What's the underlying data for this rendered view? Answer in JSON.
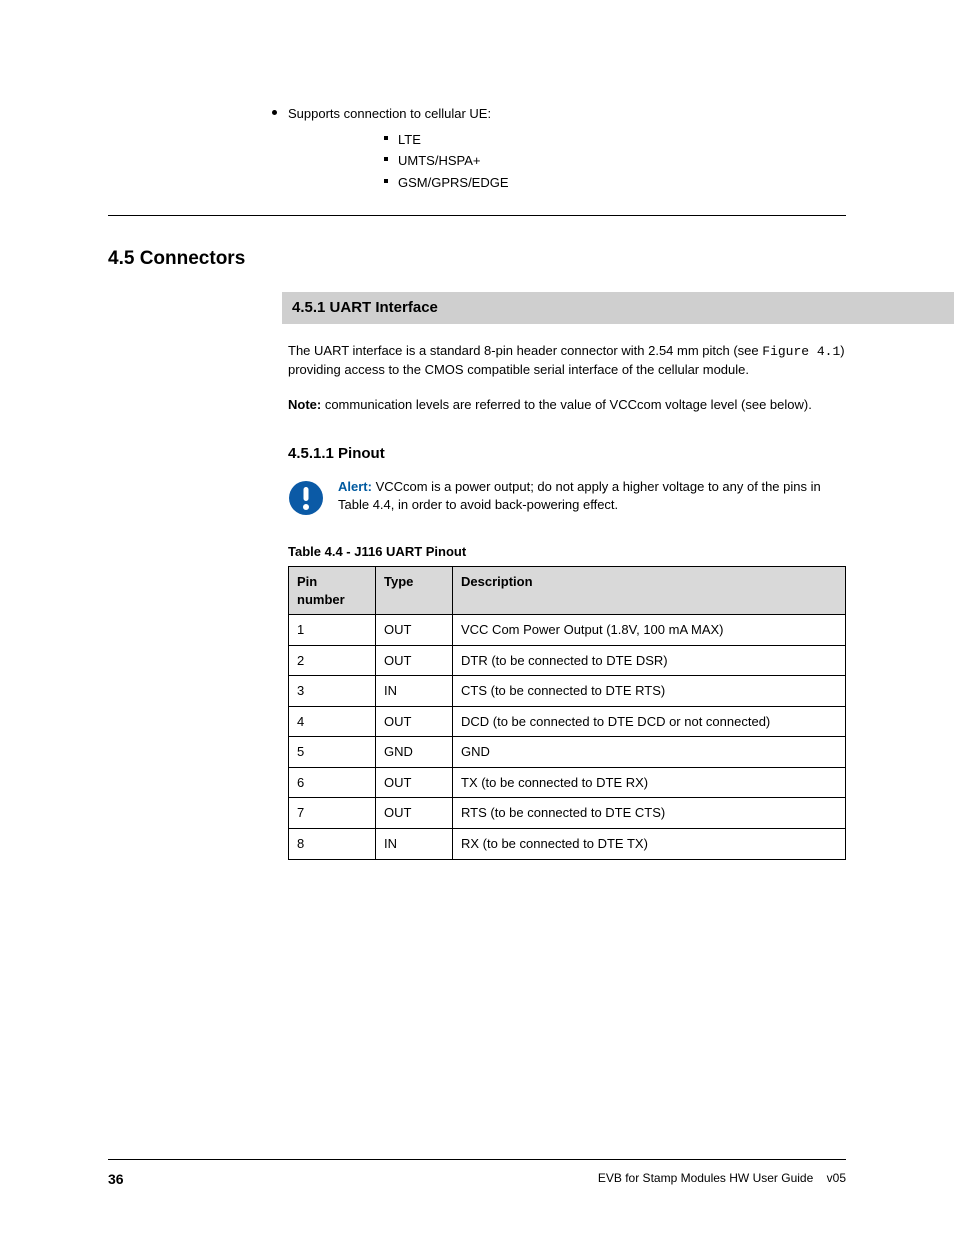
{
  "top_bullet": {
    "line1": "Supports connection to cellular UE:",
    "sub": [
      "LTE",
      "UMTS/HSPA+",
      "GSM/GPRS/EDGE"
    ]
  },
  "section_title": "4.5   Connectors",
  "band_title": "4.5.1   UART Interface",
  "para1_pre": "The UART interface is a standard 8-pin header connector with 2.54 mm pitch (see ",
  "para1_link": "Figure 4.1",
  "para1_post": ") providing access to the CMOS compatible serial interface of the cellular module.",
  "note": {
    "label": "Note:",
    "text": " communication levels are referred to the value of VCCcom voltage level (see below)."
  },
  "subhead": "4.5.1.1   Pinout",
  "alert": {
    "label": "Alert:",
    "text_pre": " VCCcom is a power output; do not apply a higher voltage to any of the pins in ",
    "link": "Table 4.4",
    "text_post": ", in order to avoid back-powering effect."
  },
  "table_caption": "Table 4.4 - J116 UART Pinout",
  "table_headers": [
    "Pin number",
    "Type",
    "Description"
  ],
  "table_rows": [
    {
      "pin": "1",
      "type": "OUT",
      "desc": "VCC Com Power Output (1.8V, 100 mA MAX)"
    },
    {
      "pin": "2",
      "type": "OUT",
      "desc": "DTR (to be connected to DTE DSR)"
    },
    {
      "pin": "3",
      "type": "IN",
      "desc": "CTS (to be connected to DTE RTS)"
    },
    {
      "pin": "4",
      "type": "OUT",
      "desc": "DCD (to be connected to DTE DCD or not connected)"
    },
    {
      "pin": "5",
      "type": "GND",
      "desc": "GND"
    },
    {
      "pin": "6",
      "type": "OUT",
      "desc": "TX (to be connected to DTE RX)"
    },
    {
      "pin": "7",
      "type": "OUT",
      "desc": "RTS (to be connected to DTE CTS)"
    },
    {
      "pin": "8",
      "type": "IN",
      "desc": "RX (to be connected to DTE TX)"
    }
  ],
  "footer": {
    "pageno": "36",
    "doc": "EVB for Stamp Modules HW User Guide",
    "ver": "v05"
  }
}
